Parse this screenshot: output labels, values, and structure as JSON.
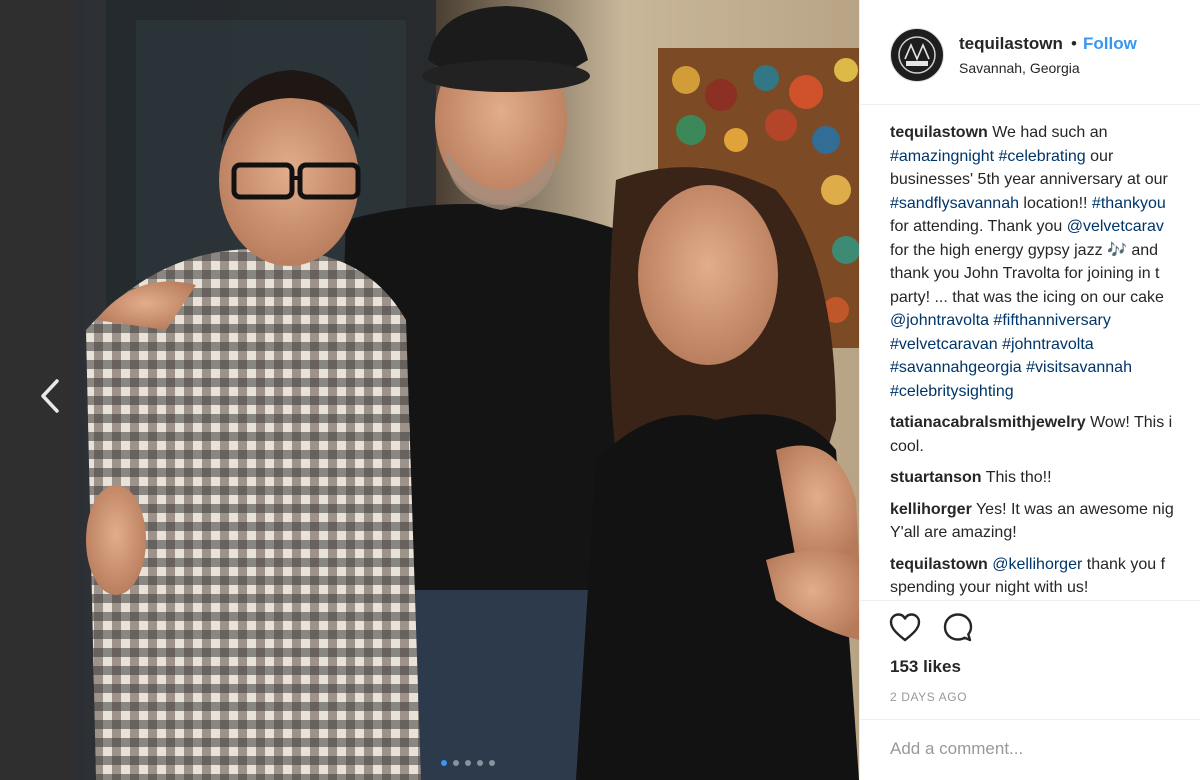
{
  "post": {
    "username": "tequilastown",
    "follow_label": "Follow",
    "bullet": "•",
    "location": "Savannah, Georgia",
    "carousel": {
      "count": 5,
      "active_index": 0
    }
  },
  "caption": {
    "user": "tequilastown",
    "lines": [
      [
        {
          "t": "We had such an",
          "tag": false
        }
      ],
      [
        {
          "t": "#amazingnight",
          "tag": true
        },
        {
          "t": " ",
          "tag": false
        },
        {
          "t": "#celebrating",
          "tag": true
        },
        {
          "t": " our",
          "tag": false
        }
      ],
      [
        {
          "t": "businesses' 5th year anniversary at our",
          "tag": false
        }
      ],
      [
        {
          "t": "#sandflysavannah",
          "tag": true
        },
        {
          "t": " location!! ",
          "tag": false
        },
        {
          "t": "#thankyou",
          "tag": true
        }
      ],
      [
        {
          "t": "for attending. Thank you ",
          "tag": false
        },
        {
          "t": "@velvetcarav",
          "tag": true
        }
      ],
      [
        {
          "t": "for the high energy gypsy jazz 🎶 and",
          "tag": false
        }
      ],
      [
        {
          "t": "thank you John Travolta for joining in t",
          "tag": false
        }
      ],
      [
        {
          "t": "party! ... that was the icing on our cake",
          "tag": false
        }
      ],
      [
        {
          "t": "@johntravolta",
          "tag": true
        },
        {
          "t": " ",
          "tag": false
        },
        {
          "t": "#fifthanniversary",
          "tag": true
        }
      ],
      [
        {
          "t": "#velvetcaravan",
          "tag": true
        },
        {
          "t": " ",
          "tag": false
        },
        {
          "t": "#johntravolta",
          "tag": true
        }
      ],
      [
        {
          "t": "#savannahgeorgia",
          "tag": true
        },
        {
          "t": " ",
          "tag": false
        },
        {
          "t": "#visitsavannah",
          "tag": true
        }
      ],
      [
        {
          "t": "#celebritysighting",
          "tag": true
        }
      ]
    ]
  },
  "comments": [
    {
      "user": "tatianacabralsmithjewelry",
      "text": "Wow! This i",
      "text2": "cool."
    },
    {
      "user": "stuartanson",
      "text": "This tho!!",
      "text2": ""
    },
    {
      "user": "kellihorger",
      "text": "Yes! It was an awesome nig",
      "text2": "Y'all are amazing!"
    },
    {
      "user": "tequilastown",
      "mention": "@kellihorger",
      "text": " thank you f",
      "text2": "spending your night with us!"
    }
  ],
  "engagement": {
    "likes": "153 likes",
    "timestamp": "2 DAYS AGO",
    "add_comment_placeholder": "Add a comment..."
  },
  "icons": {
    "prev": "chevron-left-icon",
    "like": "heart-icon",
    "comment": "comment-bubble-icon"
  },
  "colors": {
    "link_blue": "#3897f0",
    "tag_navy": "#003569",
    "text": "#262626",
    "muted": "#999999"
  }
}
